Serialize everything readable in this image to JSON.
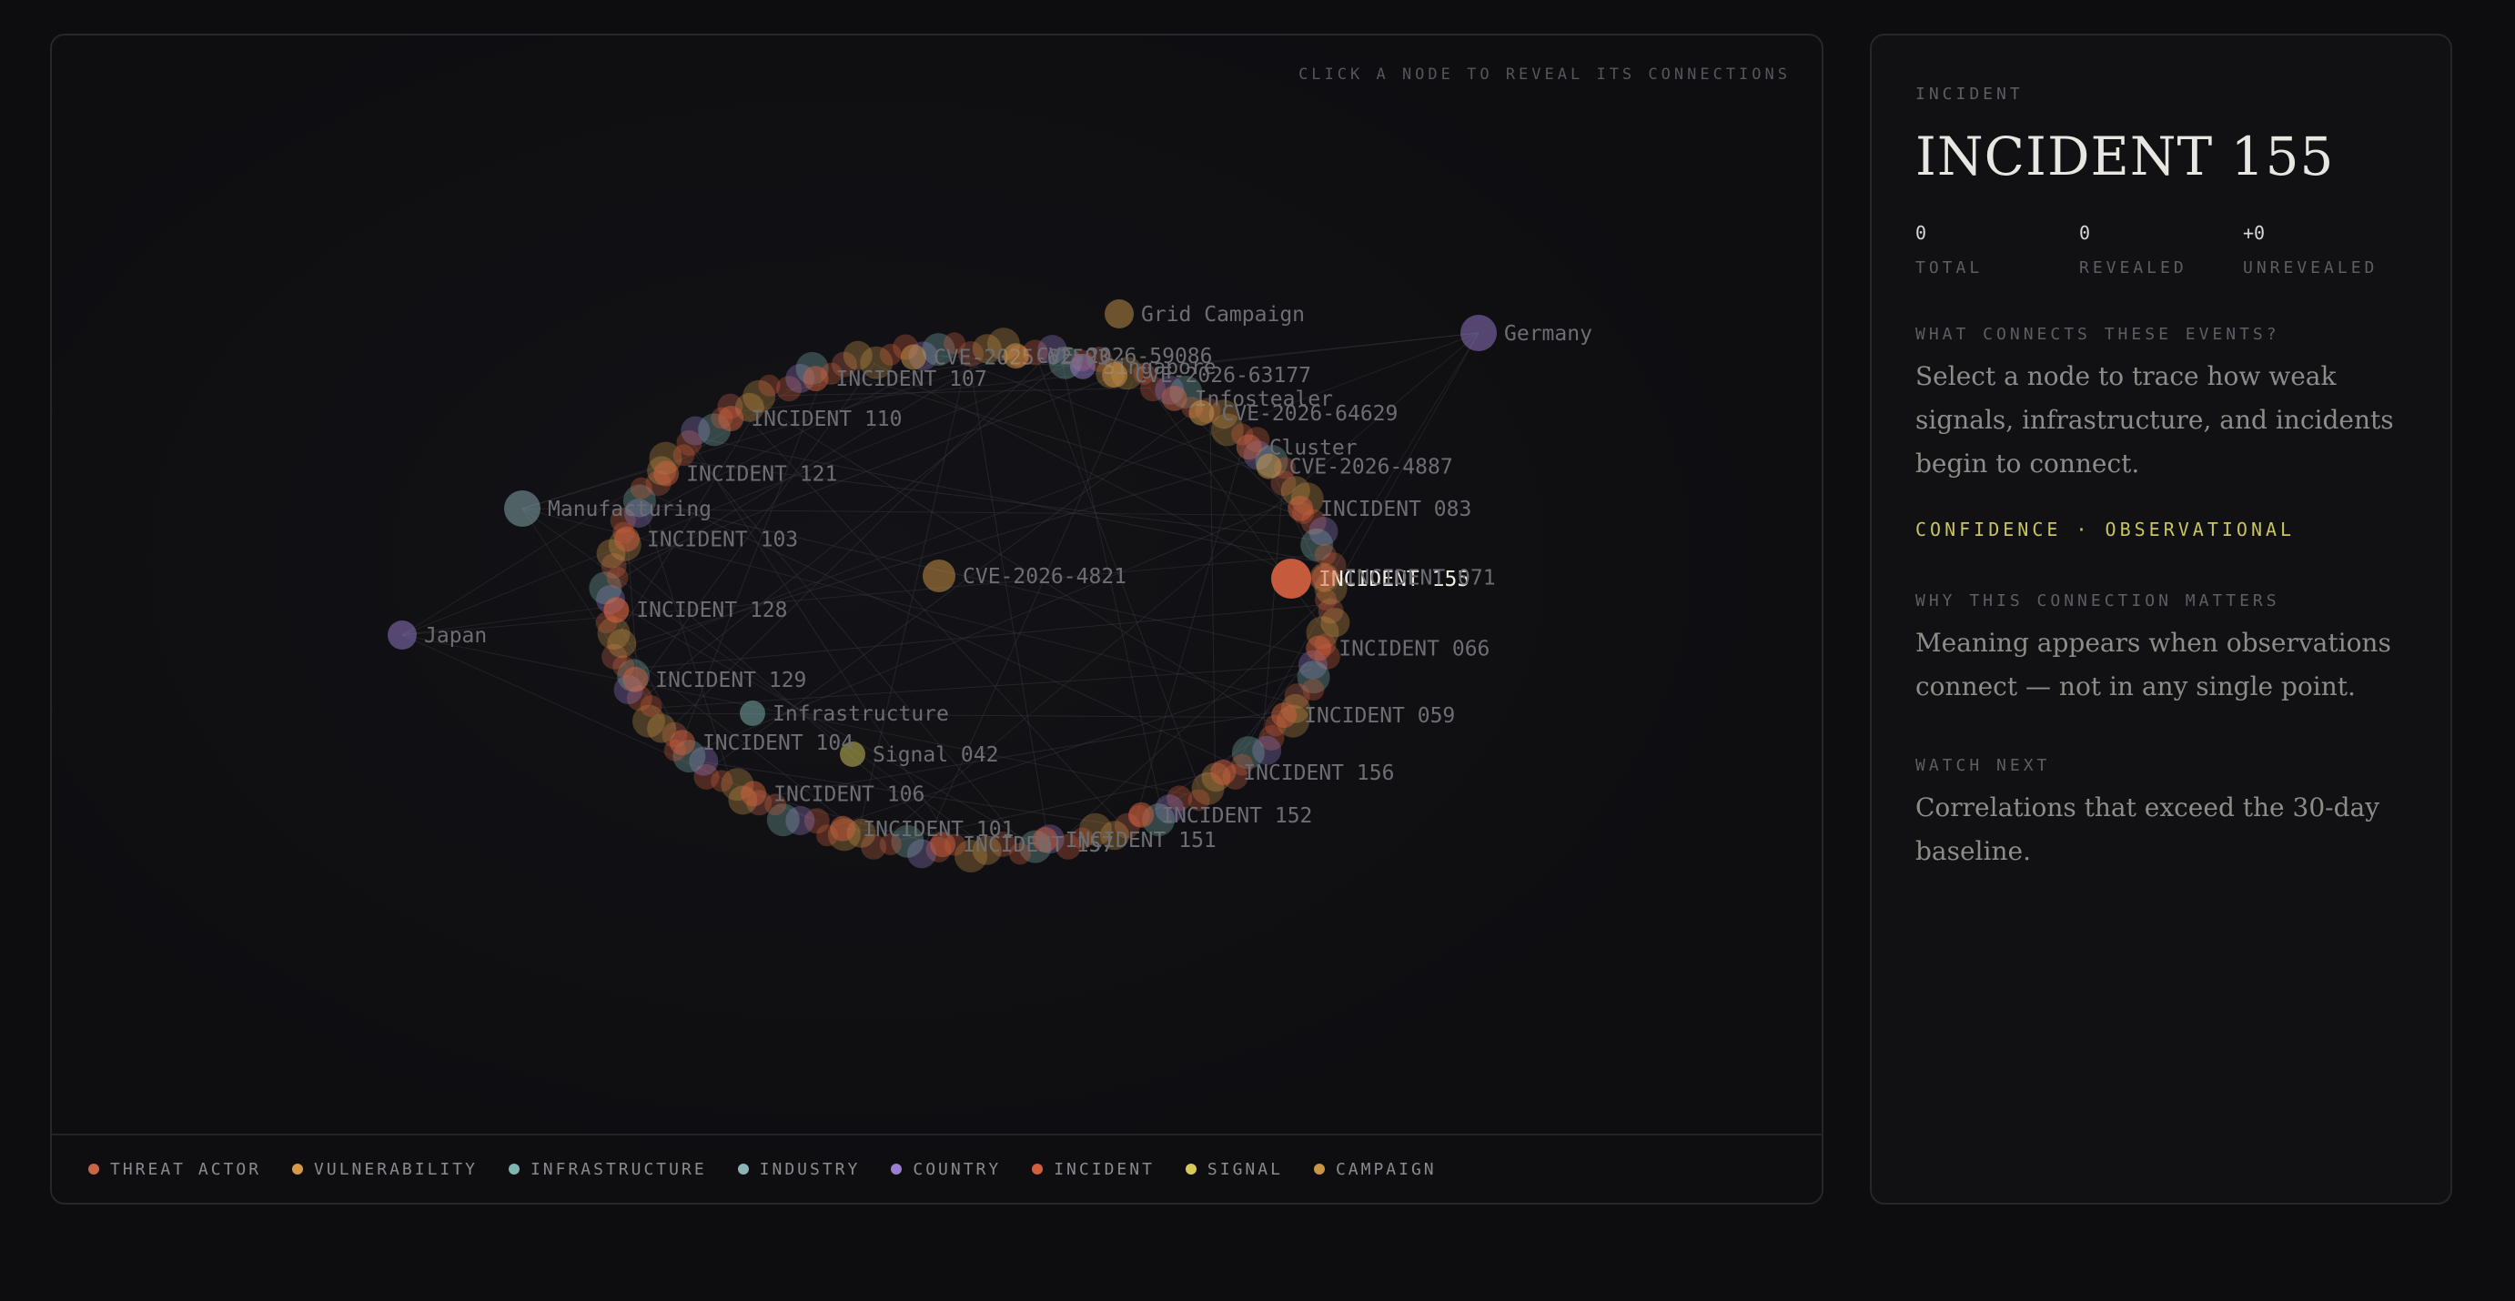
{
  "graph": {
    "hint": "CLICK A NODE TO REVEAL ITS CONNECTIONS",
    "nodes": [
      {
        "label": "Germany",
        "type": "country"
      },
      {
        "label": "Japan",
        "type": "country"
      },
      {
        "label": "Singapore",
        "type": "country"
      },
      {
        "label": "Manufacturing",
        "type": "industry"
      },
      {
        "label": "CVE-2026-4821",
        "type": "vulnerability"
      },
      {
        "label": "Grid Campaign",
        "type": "campaign"
      },
      {
        "label": "Signal 042",
        "type": "signal"
      },
      {
        "label": "Infrastructure",
        "type": "infrastructure"
      },
      {
        "label": "Infostealer",
        "type": "threat_actor"
      },
      {
        "label": "Cluster",
        "type": "threat_actor"
      },
      {
        "label": "INCIDENT 155",
        "type": "incident",
        "selected": true
      },
      {
        "label": "INCIDENT 083",
        "type": "incident"
      },
      {
        "label": "INCIDENT 071",
        "type": "incident"
      },
      {
        "label": "INCIDENT 066",
        "type": "incident"
      },
      {
        "label": "INCIDENT 059",
        "type": "incident"
      },
      {
        "label": "INCIDENT 156",
        "type": "incident"
      },
      {
        "label": "INCIDENT 152",
        "type": "incident"
      },
      {
        "label": "INCIDENT 151",
        "type": "incident"
      },
      {
        "label": "INCIDENT 157",
        "type": "incident"
      },
      {
        "label": "INCIDENT 101",
        "type": "incident"
      },
      {
        "label": "INCIDENT 106",
        "type": "incident"
      },
      {
        "label": "INCIDENT 104",
        "type": "incident"
      },
      {
        "label": "INCIDENT 129",
        "type": "incident"
      },
      {
        "label": "INCIDENT 128",
        "type": "incident"
      },
      {
        "label": "INCIDENT 103",
        "type": "incident"
      },
      {
        "label": "INCIDENT 121",
        "type": "incident"
      },
      {
        "label": "INCIDENT 110",
        "type": "incident"
      },
      {
        "label": "INCIDENT 107",
        "type": "incident"
      },
      {
        "label": "CVE-2025-62593",
        "type": "vulnerability"
      },
      {
        "label": "CVE-2026-59086",
        "type": "vulnerability"
      },
      {
        "label": "CVE-2026-63177",
        "type": "vulnerability"
      },
      {
        "label": "CVE-2026-64629",
        "type": "vulnerability"
      },
      {
        "label": "CVE-2026-4887",
        "type": "vulnerability"
      }
    ]
  },
  "legend": [
    {
      "label": "THREAT ACTOR",
      "color": "#c8664a"
    },
    {
      "label": "VULNERABILITY",
      "color": "#d49a4a"
    },
    {
      "label": "INFRASTRUCTURE",
      "color": "#7fb6b2"
    },
    {
      "label": "INDUSTRY",
      "color": "#8fb2b8"
    },
    {
      "label": "COUNTRY",
      "color": "#9a7ed0"
    },
    {
      "label": "INCIDENT",
      "color": "#d0603e"
    },
    {
      "label": "SIGNAL",
      "color": "#d6c95a"
    },
    {
      "label": "CAMPAIGN",
      "color": "#c99548"
    }
  ],
  "detail": {
    "kind": "INCIDENT",
    "title": "INCIDENT 155",
    "stats": [
      {
        "value": "0",
        "label": "TOTAL"
      },
      {
        "value": "0",
        "label": "REVEALED"
      },
      {
        "value": "+0",
        "label": "UNREVEALED"
      }
    ],
    "q1_label": "WHAT CONNECTS THESE EVENTS?",
    "q1_text": "Select a node to trace how weak signals, infrastructure, and incidents begin to connect.",
    "confidence": "CONFIDENCE · OBSERVATIONAL",
    "q2_label": "WHY THIS CONNECTION MATTERS",
    "q2_text": "Meaning appears when observations connect — not in any single point.",
    "q3_label": "WATCH NEXT",
    "q3_text": "Correlations that exceed the 30-day baseline."
  }
}
